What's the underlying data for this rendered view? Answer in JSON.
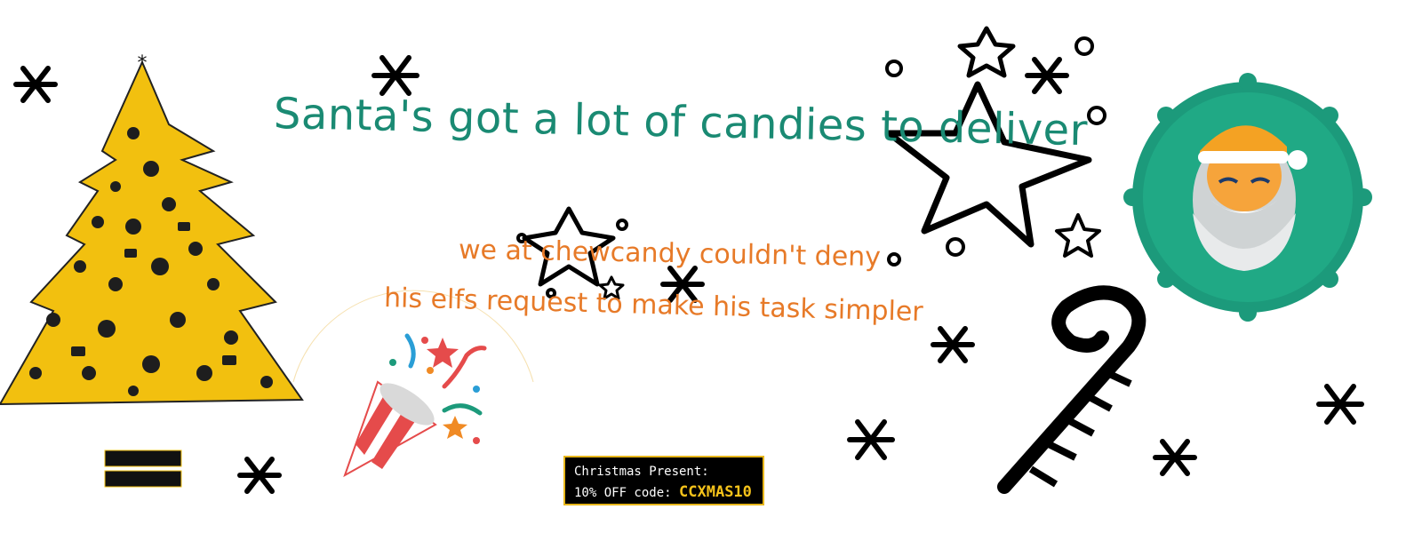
{
  "banner": {
    "headline": "Santa's got a lot of candies to deliver",
    "subline_1": "we at chewcandy couldn't deny",
    "subline_2": "his elfs request to make his task simpler"
  },
  "promo": {
    "label": "Christmas Present:",
    "offer_prefix": "10% OFF code:",
    "code": "CCXMAS10"
  },
  "colors": {
    "headline": "#1a8a73",
    "subline": "#e77a28",
    "tree_gold": "#f2c00f",
    "wreath_green": "#1c9a7b",
    "santa_hat": "#f4a223",
    "promo_background": "#000000",
    "promo_code": "#f4c21a",
    "doodle": "#000000"
  },
  "icons": [
    "christmas-tree-illustration",
    "party-popper-illustration",
    "santa-wreath-illustration",
    "candy-cane-icon",
    "star-icon",
    "snowflake-icon"
  ]
}
